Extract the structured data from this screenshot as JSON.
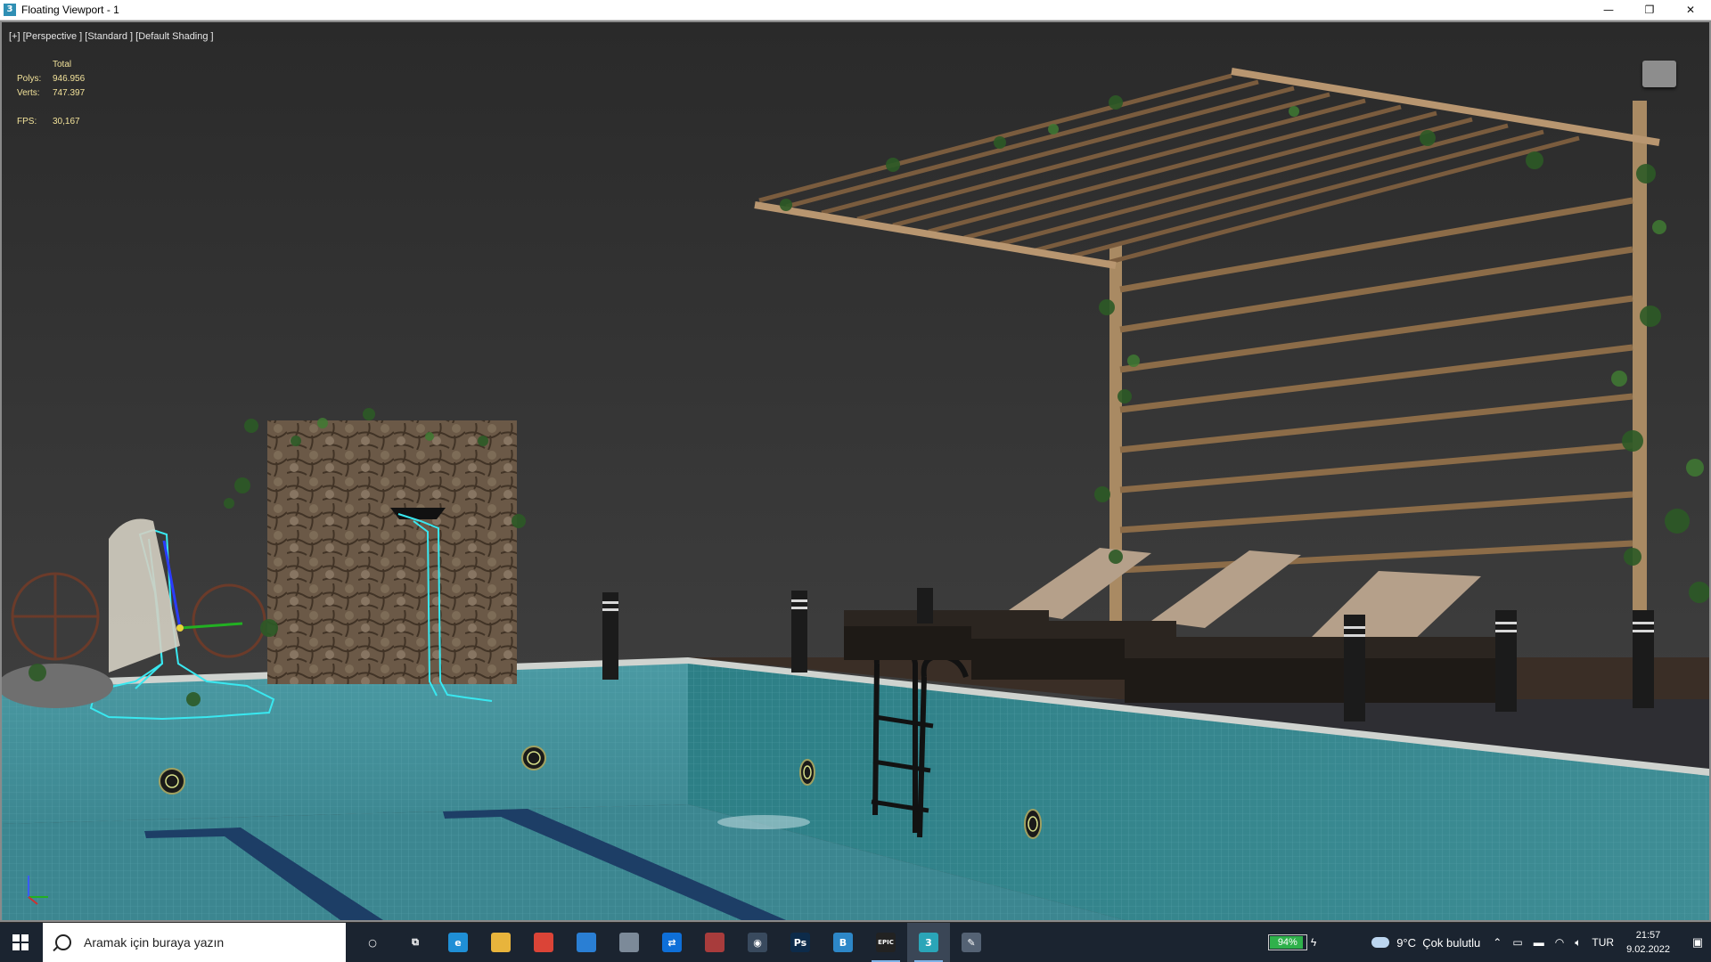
{
  "window": {
    "title": "Floating Viewport - 1",
    "controls": {
      "minimize": "—",
      "restore": "❐",
      "close": "✕"
    }
  },
  "viewport": {
    "label": "[+] [Perspective ] [Standard ] [Default Shading ]",
    "stats": {
      "header": "Total",
      "polys_label": "Polys:",
      "polys": "946.956",
      "verts_label": "Verts:",
      "verts": "747.397",
      "fps_label": "FPS:",
      "fps": "30,167"
    }
  },
  "taskbar": {
    "search_placeholder": "Aramak için buraya yazın",
    "apps": [
      {
        "name": "cortana-icon",
        "glyph": "○",
        "color": "#1b2430"
      },
      {
        "name": "task-view-icon",
        "glyph": "⧉",
        "color": "#1b2430"
      },
      {
        "name": "edge-icon",
        "glyph": "e",
        "color": "#1f8fd6"
      },
      {
        "name": "file-explorer-icon",
        "glyph": "",
        "color": "#e8b43c"
      },
      {
        "name": "chrome-icon",
        "glyph": "",
        "color": "#db4437"
      },
      {
        "name": "store-icon",
        "glyph": "",
        "color": "#2a7fd4"
      },
      {
        "name": "app-icon-1",
        "glyph": "",
        "color": "#7c8a99"
      },
      {
        "name": "teamviewer-icon",
        "glyph": "⇄",
        "color": "#0e6fd8"
      },
      {
        "name": "winrar-icon",
        "glyph": "",
        "color": "#a83c3c"
      },
      {
        "name": "camera-icon",
        "glyph": "◉",
        "color": "#394a5e"
      },
      {
        "name": "photoshop-icon",
        "glyph": "Ps",
        "color": "#0d2b4a"
      },
      {
        "name": "app-b-icon",
        "glyph": "B",
        "color": "#2d87c8"
      },
      {
        "name": "epic-games-icon",
        "glyph": "EPIC",
        "color": "#222222"
      },
      {
        "name": "3dsmax-icon",
        "glyph": "3",
        "color": "#2aa5b8"
      },
      {
        "name": "app-icon-2",
        "glyph": "✎",
        "color": "#546274"
      }
    ],
    "battery": {
      "percent_label": "94%",
      "percent": 94
    },
    "weather": {
      "temp": "9°C",
      "desc": "Çok bulutlu"
    },
    "language": "TUR",
    "time": "21:57",
    "date": "9.02.2022"
  }
}
